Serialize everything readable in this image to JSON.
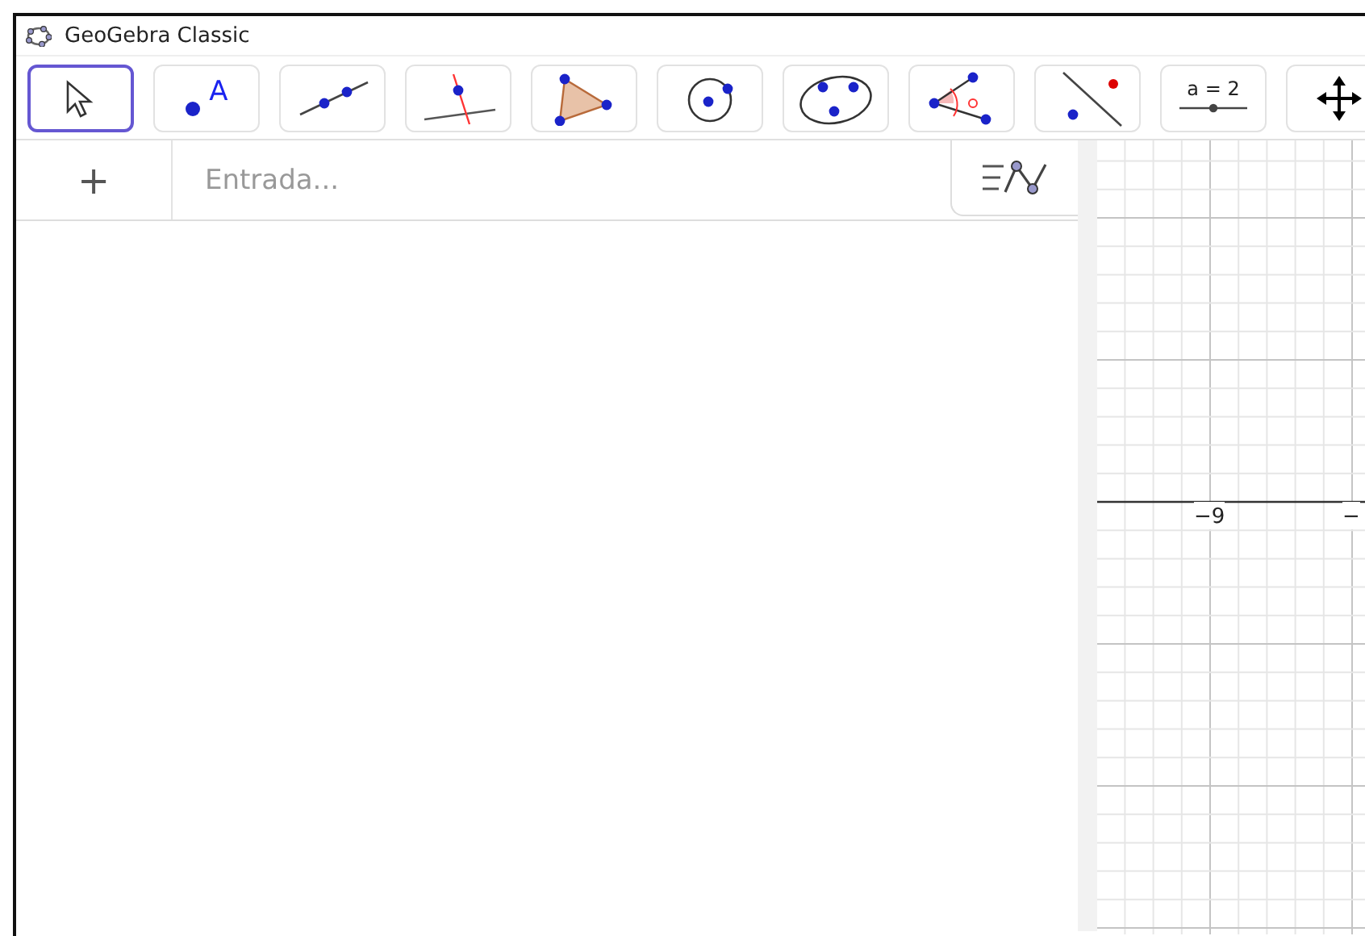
{
  "window": {
    "title": "GeoGebra Classic"
  },
  "toolbar": [
    {
      "kind": "move",
      "selected": true
    },
    {
      "kind": "point",
      "selected": false,
      "label": "A"
    },
    {
      "kind": "line",
      "selected": false
    },
    {
      "kind": "perpendicular",
      "selected": false
    },
    {
      "kind": "polygon",
      "selected": false
    },
    {
      "kind": "circle",
      "selected": false
    },
    {
      "kind": "ellipse",
      "selected": false
    },
    {
      "kind": "angle",
      "selected": false
    },
    {
      "kind": "reflect",
      "selected": false
    },
    {
      "kind": "slider",
      "selected": false,
      "label": "a = 2"
    },
    {
      "kind": "pan",
      "selected": false
    }
  ],
  "algebra": {
    "add_button": "+",
    "input": {
      "placeholder": "Entrada..."
    }
  },
  "graphics": {
    "x_tick_labels": [
      "−9",
      "−"
    ]
  }
}
